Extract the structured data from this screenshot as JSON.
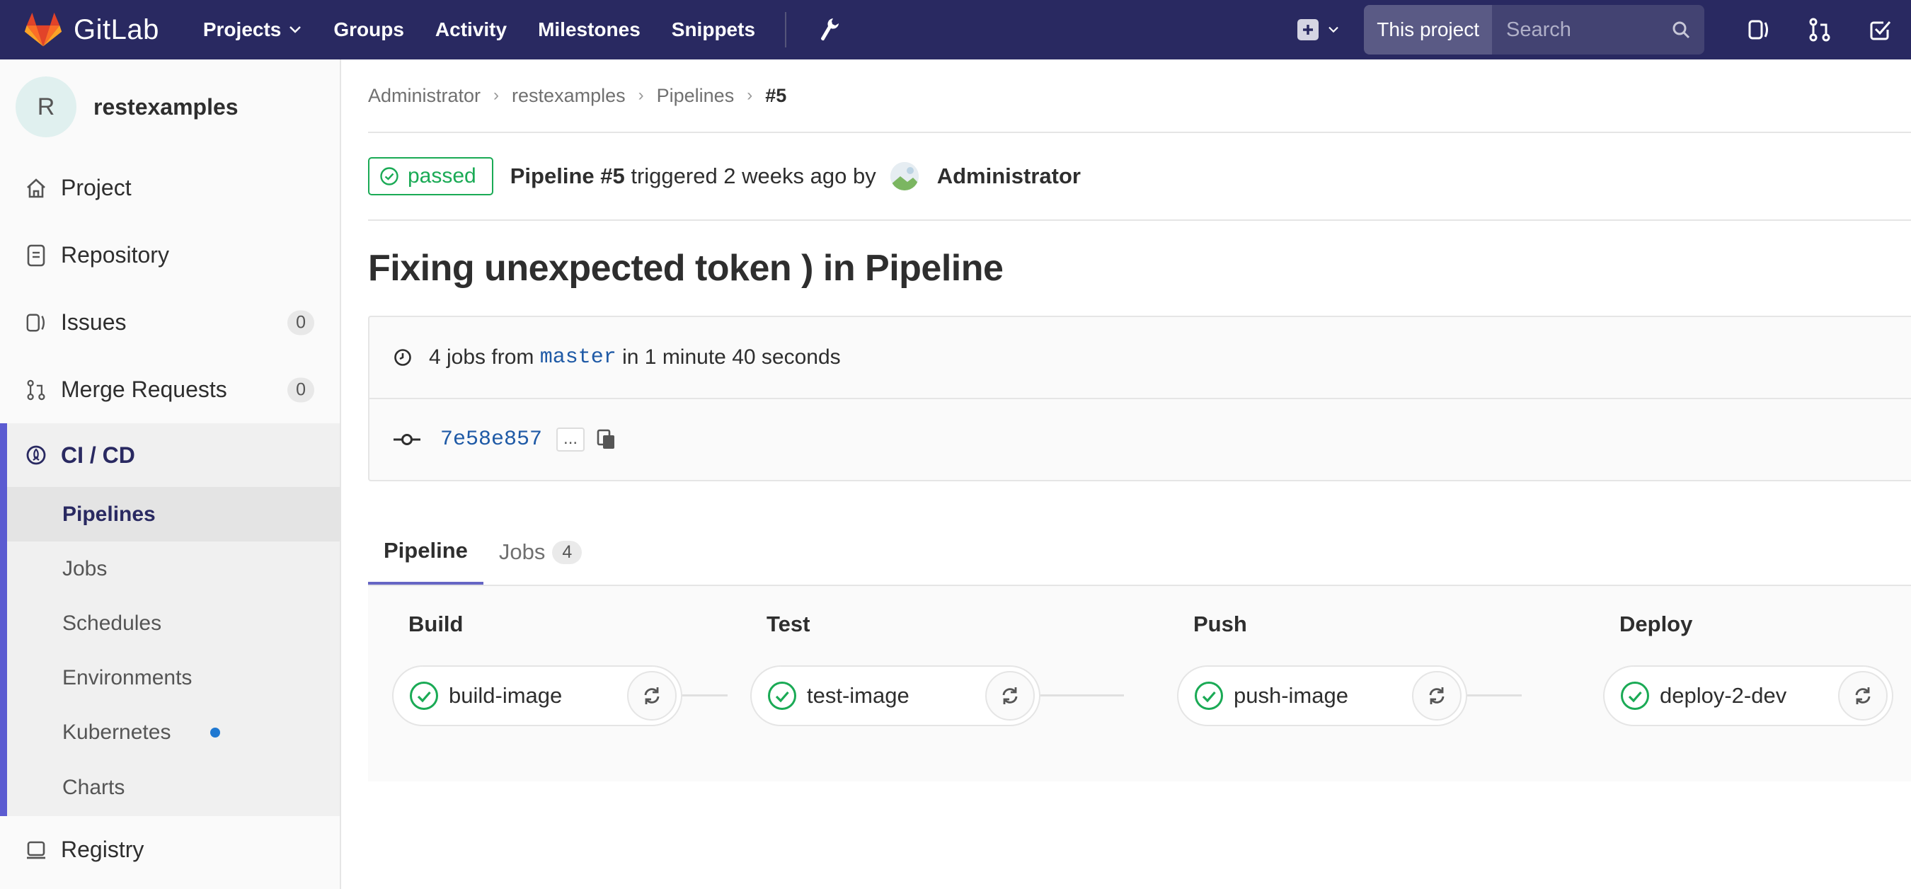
{
  "navbar": {
    "brand": "GitLab",
    "links": [
      "Projects",
      "Groups",
      "Activity",
      "Milestones",
      "Snippets"
    ],
    "search_scope": "This project",
    "search_placeholder": "Search"
  },
  "sidebar": {
    "avatar_letter": "R",
    "project_name": "restexamples",
    "items": [
      {
        "label": "Project",
        "icon": "home-icon"
      },
      {
        "label": "Repository",
        "icon": "doc-icon"
      },
      {
        "label": "Issues",
        "icon": "issues-icon",
        "count": "0"
      },
      {
        "label": "Merge Requests",
        "icon": "merge-request-icon",
        "count": "0"
      }
    ],
    "cicd_label": "CI / CD",
    "subitems": [
      "Pipelines",
      "Jobs",
      "Schedules",
      "Environments",
      "Kubernetes",
      "Charts"
    ],
    "registry_label": "Registry"
  },
  "breadcrumb": [
    "Administrator",
    "restexamples",
    "Pipelines",
    "#5"
  ],
  "pipeline": {
    "status": "passed",
    "status_color": "#1aaa55",
    "name": "Pipeline #5",
    "triggered_text": "triggered 2 weeks ago by",
    "user": "Administrator",
    "title": "Fixing unexpected token ) in Pipeline",
    "jobs_prefix": "4 jobs from",
    "branch": "master",
    "duration_text": "in 1 minute 40 seconds",
    "commit_sha": "7e58e857",
    "ellipsis": "..."
  },
  "tabs": [
    {
      "label": "Pipeline",
      "active": true
    },
    {
      "label": "Jobs",
      "count": "4"
    }
  ],
  "stages": [
    {
      "name": "Build",
      "job": "build-image"
    },
    {
      "name": "Test",
      "job": "test-image"
    },
    {
      "name": "Push",
      "job": "push-image"
    },
    {
      "name": "Deploy",
      "job": "deploy-2-dev"
    }
  ],
  "colors": {
    "navbar": "#292961",
    "accent": "#6666c4",
    "success": "#1aaa55",
    "link": "#1f5aa6"
  }
}
